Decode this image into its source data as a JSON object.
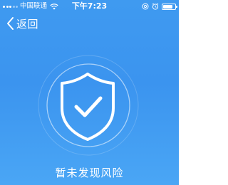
{
  "status_bar": {
    "carrier": "中国联通",
    "time": "下午7:23",
    "icons": [
      "signal-icon",
      "wifi-icon",
      "at-icon",
      "alarm-icon",
      "battery-icon"
    ]
  },
  "nav": {
    "back_label": "返回"
  },
  "main": {
    "result_text": "暂未发现风险",
    "icon": "shield-check-icon"
  },
  "colors": {
    "background_top": "#3f9af0",
    "background_bottom": "#4aa6f5",
    "foreground": "#ffffff"
  }
}
